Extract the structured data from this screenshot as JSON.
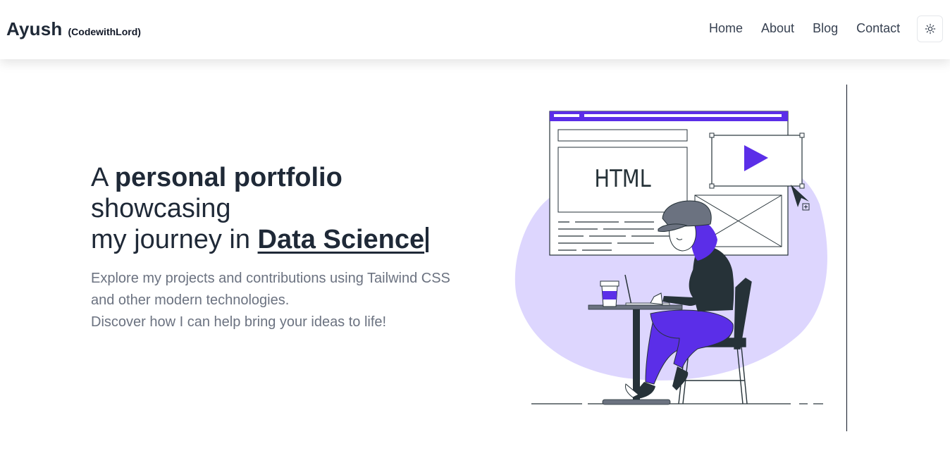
{
  "brand": {
    "name": "Ayush",
    "tag": "(CodewithLord)"
  },
  "nav": {
    "items": [
      "Home",
      "About",
      "Blog",
      "Contact"
    ],
    "theme_toggle_icon": "sun-icon"
  },
  "hero": {
    "line1_prefix": "A",
    "line1_bold": "personal portfolio",
    "line2": "showcasing",
    "line3_prefix": "my journey in",
    "line3_highlight": "Data Science",
    "description_lines": [
      "Explore my projects and contributions using Tailwind CSS",
      "and other modern technologies.",
      "Discover how I can help bring your ideas to life!"
    ]
  },
  "illustration": {
    "browser_text": "HTML",
    "accent_color": "#5b2ee8",
    "blob_color": "#ddd6fe",
    "dark_color": "#263238"
  }
}
